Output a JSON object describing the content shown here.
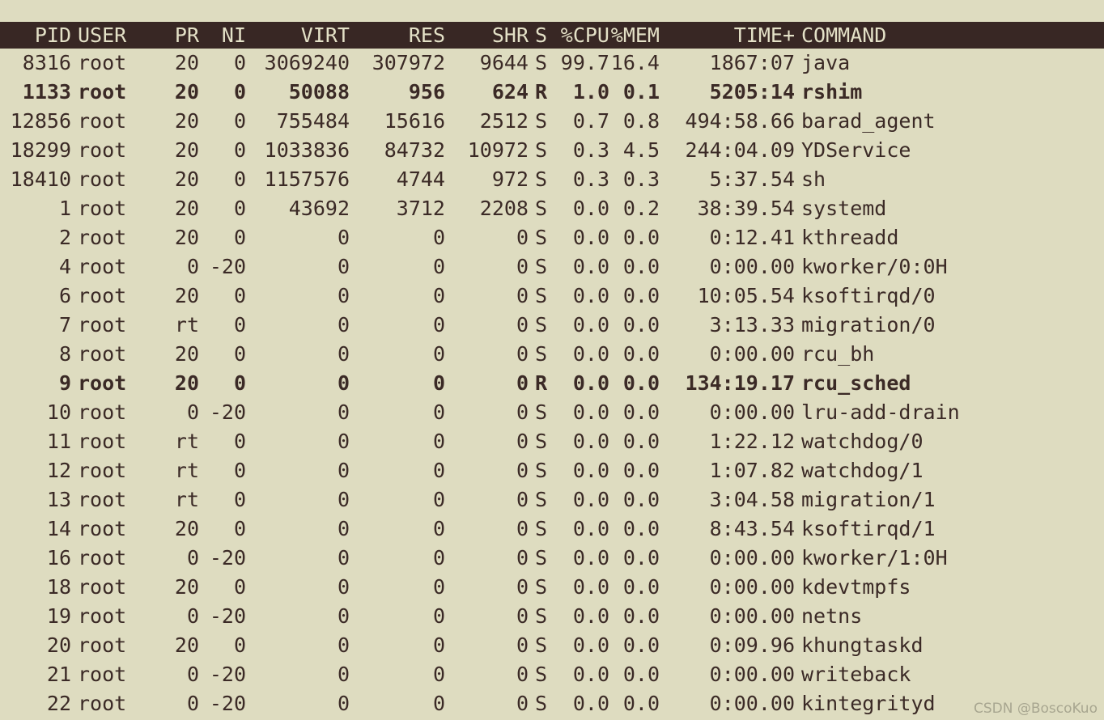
{
  "terminal": {
    "program": "top",
    "colors": {
      "background": "#dedcc0",
      "foreground": "#3b2a26",
      "header_background": "#382724",
      "header_foreground": "#e4e1c7"
    }
  },
  "table": {
    "columns": [
      {
        "key": "pid",
        "label": "PID",
        "align": "right"
      },
      {
        "key": "user",
        "label": "USER",
        "align": "left"
      },
      {
        "key": "pr",
        "label": "PR",
        "align": "right"
      },
      {
        "key": "ni",
        "label": "NI",
        "align": "right"
      },
      {
        "key": "virt",
        "label": "VIRT",
        "align": "right"
      },
      {
        "key": "res",
        "label": "RES",
        "align": "right"
      },
      {
        "key": "shr",
        "label": "SHR",
        "align": "right"
      },
      {
        "key": "s",
        "label": "S",
        "align": "left"
      },
      {
        "key": "cpu",
        "label": "%CPU",
        "align": "right"
      },
      {
        "key": "mem",
        "label": "%MEM",
        "align": "right"
      },
      {
        "key": "time",
        "label": "TIME+",
        "align": "right"
      },
      {
        "key": "command",
        "label": "COMMAND",
        "align": "left"
      }
    ],
    "rows": [
      {
        "pid": "8316",
        "user": "root",
        "pr": "20",
        "ni": "0",
        "virt": "3069240",
        "res": "307972",
        "shr": "9644",
        "s": "S",
        "cpu": "99.7",
        "mem": "16.4",
        "time": "1867:07",
        "command": "java",
        "bold": false
      },
      {
        "pid": "1133",
        "user": "root",
        "pr": "20",
        "ni": "0",
        "virt": "50088",
        "res": "956",
        "shr": "624",
        "s": "R",
        "cpu": "1.0",
        "mem": "0.1",
        "time": "5205:14",
        "command": "rshim",
        "bold": true
      },
      {
        "pid": "12856",
        "user": "root",
        "pr": "20",
        "ni": "0",
        "virt": "755484",
        "res": "15616",
        "shr": "2512",
        "s": "S",
        "cpu": "0.7",
        "mem": "0.8",
        "time": "494:58.66",
        "command": "barad_agent",
        "bold": false
      },
      {
        "pid": "18299",
        "user": "root",
        "pr": "20",
        "ni": "0",
        "virt": "1033836",
        "res": "84732",
        "shr": "10972",
        "s": "S",
        "cpu": "0.3",
        "mem": "4.5",
        "time": "244:04.09",
        "command": "YDService",
        "bold": false
      },
      {
        "pid": "18410",
        "user": "root",
        "pr": "20",
        "ni": "0",
        "virt": "1157576",
        "res": "4744",
        "shr": "972",
        "s": "S",
        "cpu": "0.3",
        "mem": "0.3",
        "time": "5:37.54",
        "command": "sh",
        "bold": false
      },
      {
        "pid": "1",
        "user": "root",
        "pr": "20",
        "ni": "0",
        "virt": "43692",
        "res": "3712",
        "shr": "2208",
        "s": "S",
        "cpu": "0.0",
        "mem": "0.2",
        "time": "38:39.54",
        "command": "systemd",
        "bold": false
      },
      {
        "pid": "2",
        "user": "root",
        "pr": "20",
        "ni": "0",
        "virt": "0",
        "res": "0",
        "shr": "0",
        "s": "S",
        "cpu": "0.0",
        "mem": "0.0",
        "time": "0:12.41",
        "command": "kthreadd",
        "bold": false
      },
      {
        "pid": "4",
        "user": "root",
        "pr": "0",
        "ni": "-20",
        "virt": "0",
        "res": "0",
        "shr": "0",
        "s": "S",
        "cpu": "0.0",
        "mem": "0.0",
        "time": "0:00.00",
        "command": "kworker/0:0H",
        "bold": false
      },
      {
        "pid": "6",
        "user": "root",
        "pr": "20",
        "ni": "0",
        "virt": "0",
        "res": "0",
        "shr": "0",
        "s": "S",
        "cpu": "0.0",
        "mem": "0.0",
        "time": "10:05.54",
        "command": "ksoftirqd/0",
        "bold": false
      },
      {
        "pid": "7",
        "user": "root",
        "pr": "rt",
        "ni": "0",
        "virt": "0",
        "res": "0",
        "shr": "0",
        "s": "S",
        "cpu": "0.0",
        "mem": "0.0",
        "time": "3:13.33",
        "command": "migration/0",
        "bold": false
      },
      {
        "pid": "8",
        "user": "root",
        "pr": "20",
        "ni": "0",
        "virt": "0",
        "res": "0",
        "shr": "0",
        "s": "S",
        "cpu": "0.0",
        "mem": "0.0",
        "time": "0:00.00",
        "command": "rcu_bh",
        "bold": false
      },
      {
        "pid": "9",
        "user": "root",
        "pr": "20",
        "ni": "0",
        "virt": "0",
        "res": "0",
        "shr": "0",
        "s": "R",
        "cpu": "0.0",
        "mem": "0.0",
        "time": "134:19.17",
        "command": "rcu_sched",
        "bold": true
      },
      {
        "pid": "10",
        "user": "root",
        "pr": "0",
        "ni": "-20",
        "virt": "0",
        "res": "0",
        "shr": "0",
        "s": "S",
        "cpu": "0.0",
        "mem": "0.0",
        "time": "0:00.00",
        "command": "lru-add-drain",
        "bold": false
      },
      {
        "pid": "11",
        "user": "root",
        "pr": "rt",
        "ni": "0",
        "virt": "0",
        "res": "0",
        "shr": "0",
        "s": "S",
        "cpu": "0.0",
        "mem": "0.0",
        "time": "1:22.12",
        "command": "watchdog/0",
        "bold": false
      },
      {
        "pid": "12",
        "user": "root",
        "pr": "rt",
        "ni": "0",
        "virt": "0",
        "res": "0",
        "shr": "0",
        "s": "S",
        "cpu": "0.0",
        "mem": "0.0",
        "time": "1:07.82",
        "command": "watchdog/1",
        "bold": false
      },
      {
        "pid": "13",
        "user": "root",
        "pr": "rt",
        "ni": "0",
        "virt": "0",
        "res": "0",
        "shr": "0",
        "s": "S",
        "cpu": "0.0",
        "mem": "0.0",
        "time": "3:04.58",
        "command": "migration/1",
        "bold": false
      },
      {
        "pid": "14",
        "user": "root",
        "pr": "20",
        "ni": "0",
        "virt": "0",
        "res": "0",
        "shr": "0",
        "s": "S",
        "cpu": "0.0",
        "mem": "0.0",
        "time": "8:43.54",
        "command": "ksoftirqd/1",
        "bold": false
      },
      {
        "pid": "16",
        "user": "root",
        "pr": "0",
        "ni": "-20",
        "virt": "0",
        "res": "0",
        "shr": "0",
        "s": "S",
        "cpu": "0.0",
        "mem": "0.0",
        "time": "0:00.00",
        "command": "kworker/1:0H",
        "bold": false
      },
      {
        "pid": "18",
        "user": "root",
        "pr": "20",
        "ni": "0",
        "virt": "0",
        "res": "0",
        "shr": "0",
        "s": "S",
        "cpu": "0.0",
        "mem": "0.0",
        "time": "0:00.00",
        "command": "kdevtmpfs",
        "bold": false
      },
      {
        "pid": "19",
        "user": "root",
        "pr": "0",
        "ni": "-20",
        "virt": "0",
        "res": "0",
        "shr": "0",
        "s": "S",
        "cpu": "0.0",
        "mem": "0.0",
        "time": "0:00.00",
        "command": "netns",
        "bold": false
      },
      {
        "pid": "20",
        "user": "root",
        "pr": "20",
        "ni": "0",
        "virt": "0",
        "res": "0",
        "shr": "0",
        "s": "S",
        "cpu": "0.0",
        "mem": "0.0",
        "time": "0:09.96",
        "command": "khungtaskd",
        "bold": false
      },
      {
        "pid": "21",
        "user": "root",
        "pr": "0",
        "ni": "-20",
        "virt": "0",
        "res": "0",
        "shr": "0",
        "s": "S",
        "cpu": "0.0",
        "mem": "0.0",
        "time": "0:00.00",
        "command": "writeback",
        "bold": false
      },
      {
        "pid": "22",
        "user": "root",
        "pr": "0",
        "ni": "-20",
        "virt": "0",
        "res": "0",
        "shr": "0",
        "s": "S",
        "cpu": "0.0",
        "mem": "0.0",
        "time": "0:00.00",
        "command": "kintegrityd",
        "bold": false
      }
    ]
  },
  "watermark": {
    "text": "CSDN @BoscoKuo"
  }
}
